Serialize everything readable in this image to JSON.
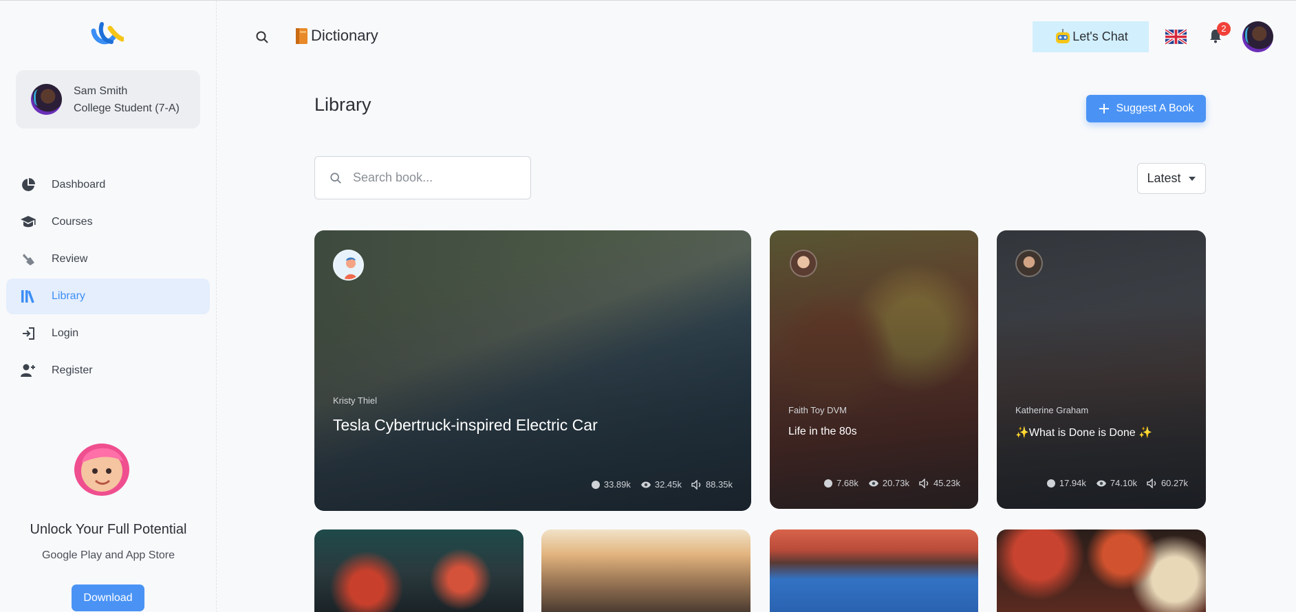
{
  "user": {
    "name": "Sam Smith",
    "role": "College Student (7-A)"
  },
  "nav": [
    {
      "label": "Dashboard",
      "icon": "pie-chart-icon"
    },
    {
      "label": "Courses",
      "icon": "graduation-cap-icon"
    },
    {
      "label": "Review",
      "icon": "hand-pointer-icon"
    },
    {
      "label": "Library",
      "icon": "library-icon",
      "active": true
    },
    {
      "label": "Login",
      "icon": "login-icon"
    },
    {
      "label": "Register",
      "icon": "add-user-icon"
    }
  ],
  "promo": {
    "title": "Unlock Your Full Potential",
    "subtitle": "Google Play and App Store",
    "button": "Download"
  },
  "header": {
    "title": "Dictionary",
    "chat_label": "Let's Chat",
    "notification_count": "2"
  },
  "page": {
    "title": "Library",
    "suggest_label": "Suggest A Book",
    "search_placeholder": "Search book...",
    "sort_label": "Latest"
  },
  "books": [
    {
      "author": "Kristy Thiel",
      "title": "Tesla Cybertruck-inspired Electric Car",
      "comments": "33.89k",
      "views": "32.45k",
      "listens": "88.35k"
    },
    {
      "author": "Faith Toy DVM",
      "title": "Life in the 80s",
      "comments": "7.68k",
      "views": "20.73k",
      "listens": "45.23k"
    },
    {
      "author": "Katherine Graham",
      "title": "✨What is Done is Done ✨",
      "comments": "17.94k",
      "views": "74.10k",
      "listens": "60.27k"
    }
  ],
  "colors": {
    "accent": "#4a93f5",
    "chat_bg": "#d2effd",
    "badge": "#f0413a"
  }
}
